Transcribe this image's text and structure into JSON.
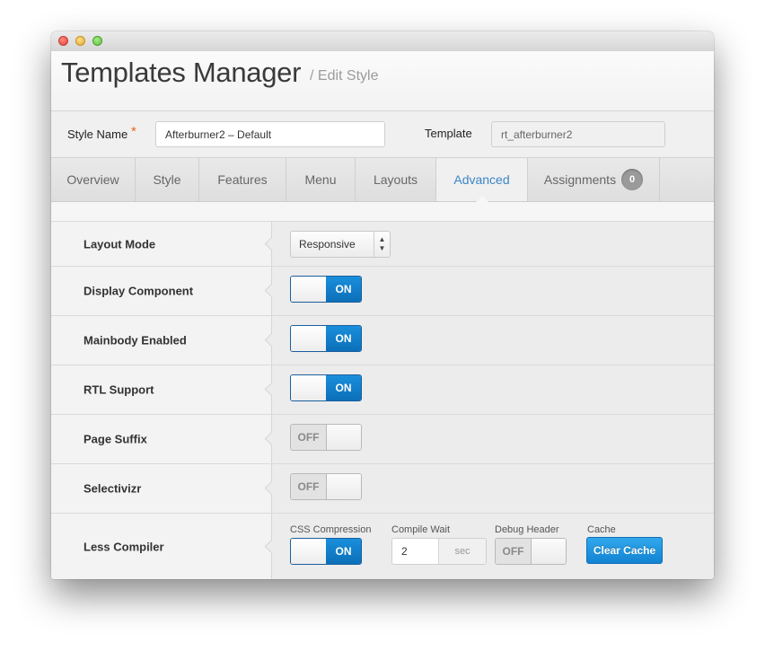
{
  "window": {
    "title": ""
  },
  "header": {
    "title": "Templates Manager",
    "subtitle": "/ Edit Style"
  },
  "style_bar": {
    "style_name_label": "Style Name",
    "required_marker": "*",
    "style_name_value": "Afterburner2 – Default",
    "template_label": "Template",
    "template_value": "rt_afterburner2"
  },
  "tabs": [
    {
      "label": "Overview"
    },
    {
      "label": "Style"
    },
    {
      "label": "Features"
    },
    {
      "label": "Menu"
    },
    {
      "label": "Layouts"
    },
    {
      "label": "Advanced",
      "active": true
    },
    {
      "label": "Assignments",
      "badge": "0"
    }
  ],
  "settings": {
    "layout_mode": {
      "label": "Layout Mode",
      "selected": "Responsive"
    },
    "display_component": {
      "label": "Display Component",
      "state": "ON"
    },
    "mainbody_enabled": {
      "label": "Mainbody Enabled",
      "state": "ON"
    },
    "rtl_support": {
      "label": "RTL Support",
      "state": "ON"
    },
    "page_suffix": {
      "label": "Page Suffix",
      "state": "OFF"
    },
    "selectivizr": {
      "label": "Selectivizr",
      "state": "OFF"
    },
    "less_compiler": {
      "label": "Less Compiler",
      "css_compression": {
        "label": "CSS Compression",
        "state": "ON"
      },
      "compile_wait": {
        "label": "Compile Wait",
        "value": "2",
        "unit": "sec"
      },
      "debug_header": {
        "label": "Debug Header",
        "state": "OFF"
      },
      "cache": {
        "label": "Cache",
        "button": "Clear Cache"
      }
    }
  },
  "colors": {
    "accent": "#0c78c6",
    "active_tab": "#3a86c8",
    "required": "#e8691d"
  }
}
